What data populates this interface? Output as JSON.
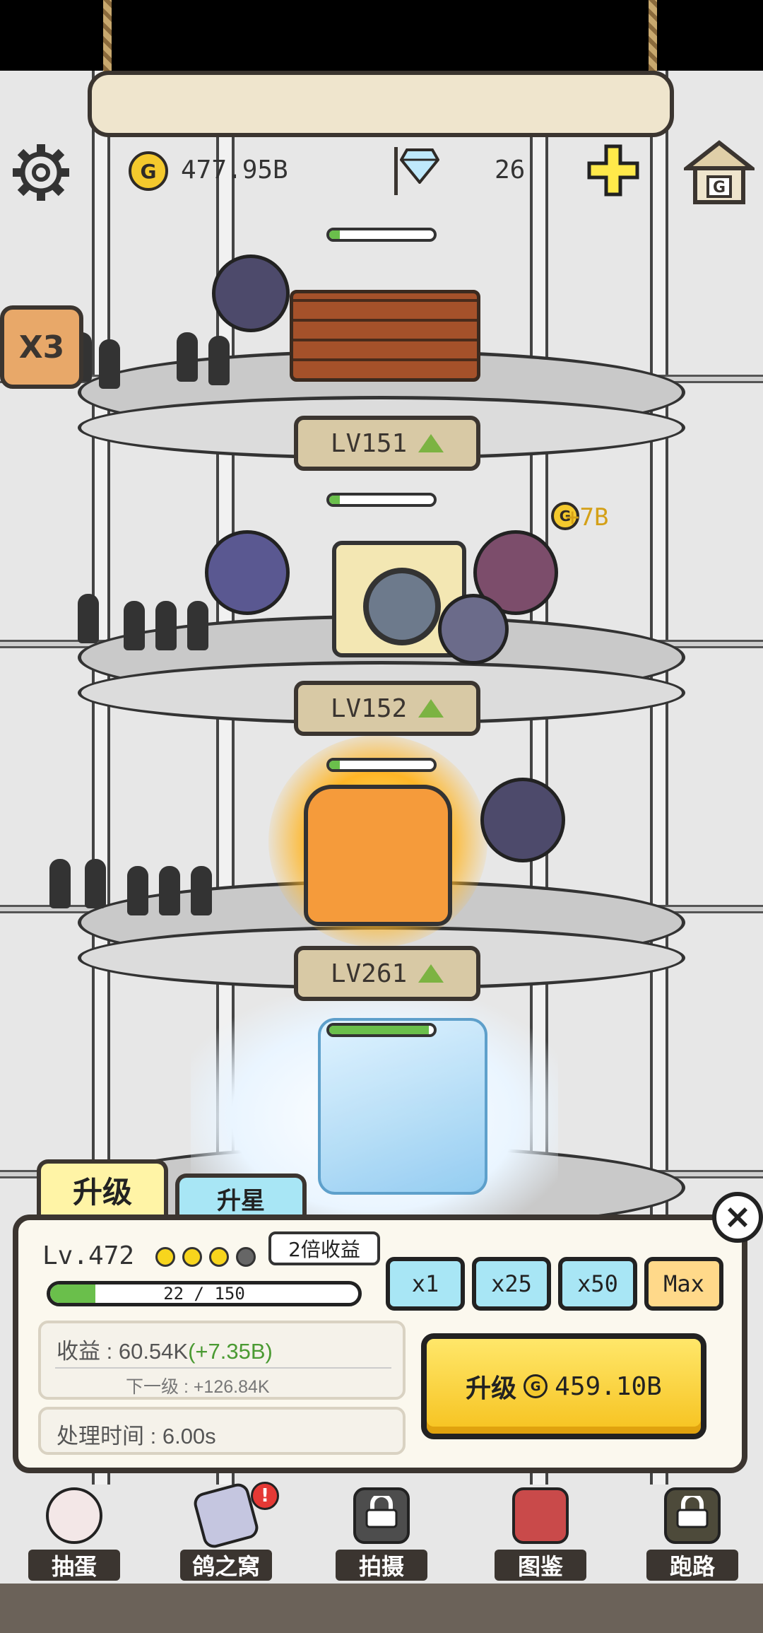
{
  "hud": {
    "gold": "477.95B",
    "gems": "26",
    "coin_symbol": "G",
    "home_symbol": "G"
  },
  "boost": {
    "label": "X3"
  },
  "floors": [
    {
      "level_label": "LV151",
      "progress": 0.1
    },
    {
      "level_label": "LV152",
      "progress": 0.1
    },
    {
      "level_label": "LV261",
      "progress": 0.1
    },
    {
      "level_label": "",
      "progress": 0.95
    }
  ],
  "floating_income": "+7B",
  "panel": {
    "tab_upgrade": "升级",
    "tab_star": "升星",
    "level_text": "Lv.472",
    "stars_filled": 3,
    "stars_total": 4,
    "bubble": "2倍收益",
    "xp_current": 22,
    "xp_max": 150,
    "xp_text": "22 / 150",
    "multipliers": [
      "x1",
      "x25",
      "x50",
      "Max"
    ],
    "income_label": "收益 : 60.54K",
    "income_bonus": "(+7.35B)",
    "next_level": "下一级 : +126.84K",
    "process_time": "处理时间 : 6.00s",
    "upgrade_label": "升级",
    "upgrade_cost": "459.10B"
  },
  "nav": [
    {
      "label": "抽蛋",
      "icon": "gashapon-icon",
      "locked": false
    },
    {
      "label": "鸽之窝",
      "icon": "nest-icon",
      "locked": false,
      "badge": "!"
    },
    {
      "label": "拍摄",
      "icon": "camera-icon",
      "locked": true
    },
    {
      "label": "图鉴",
      "icon": "book-icon",
      "locked": false
    },
    {
      "label": "跑路",
      "icon": "run-icon",
      "locked": true
    }
  ],
  "colors": {
    "accent_gold": "#f4c92d",
    "progress_green": "#6abf4b",
    "button_blue": "#a8e6f5",
    "button_yellow": "#f6c21f"
  }
}
